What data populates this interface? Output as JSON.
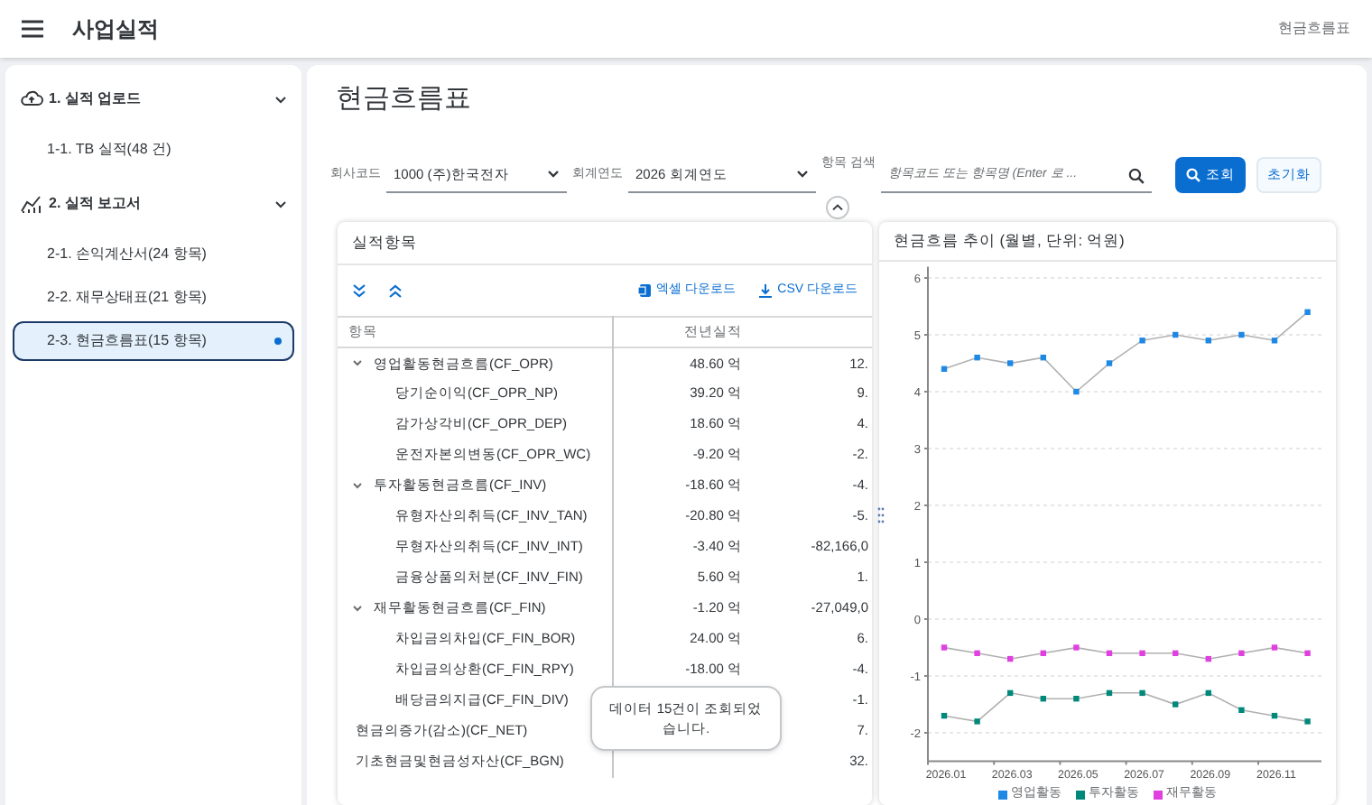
{
  "header": {
    "title": "사업실적",
    "breadcrumb": "현금흐름표"
  },
  "sidebar": {
    "groups": [
      {
        "label": "1. 실적 업로드",
        "expanded": true,
        "items": [
          {
            "label": "1-1. TB 실적(48 건)",
            "selected": false
          }
        ]
      },
      {
        "label": "2. 실적 보고서",
        "expanded": true,
        "items": [
          {
            "label": "2-1. 손익계산서(24 항목)",
            "selected": false
          },
          {
            "label": "2-2. 재무상태표(21 항목)",
            "selected": false
          },
          {
            "label": "2-3. 현금흐름표(15 항목)",
            "selected": true
          }
        ]
      }
    ]
  },
  "page_title": "현금흐름표",
  "filters": [
    {
      "kind": "select",
      "label": "회사코드",
      "value": "1000 (주)한국전자"
    },
    {
      "kind": "select",
      "label": "회계연도",
      "value": "2026 회계연도"
    },
    {
      "kind": "search",
      "label": "항목 검색",
      "placeholder": "항목코드 또는 항목명 (Enter 로 ..."
    }
  ],
  "buttons": [
    {
      "kind": "primary",
      "label": "조회"
    },
    {
      "kind": "secondary",
      "label": "초기화"
    }
  ],
  "table_card": {
    "title": "실적항목",
    "toolbar": [
      {
        "kind": "excel",
        "label": "엑셀 다운로드"
      },
      {
        "kind": "csv",
        "label": "CSV 다운로드"
      }
    ],
    "columns": [
      "항목",
      "전년실적"
    ],
    "rows": [
      {
        "name": "영업활동현금흐름(CF_OPR)",
        "expanded": true,
        "prior": "48.60 억",
        "column_3": "12.",
        "children": [
          {
            "name": "당기순이익(CF_OPR_NP)",
            "prior": "39.20 억",
            "column_3": "9."
          },
          {
            "name": "감가상각비(CF_OPR_DEP)",
            "prior": "18.60 억",
            "column_3": "4."
          },
          {
            "name": "운전자본의변동(CF_OPR_WC)",
            "prior": "-9.20 억",
            "column_3": "-2."
          }
        ]
      },
      {
        "name": "투자활동현금흐름(CF_INV)",
        "expanded": true,
        "prior": "-18.60 억",
        "column_3": "-4.",
        "children": [
          {
            "name": "유형자산의취득(CF_INV_TAN)",
            "prior": "-20.80 억",
            "column_3": "-5."
          },
          {
            "name": "무형자산의취득(CF_INV_INT)",
            "prior": "-3.40 억",
            "column_3": "-82,166,0"
          },
          {
            "name": "금융상품의처분(CF_INV_FIN)",
            "prior": "5.60 억",
            "column_3": "1."
          }
        ]
      },
      {
        "name": "재무활동현금흐름(CF_FIN)",
        "expanded": true,
        "prior": "-1.20 억",
        "column_3": "-27,049,0",
        "children": [
          {
            "name": "차입금의차입(CF_FIN_BOR)",
            "prior": "24.00 억",
            "column_3": "6."
          },
          {
            "name": "차입금의상환(CF_FIN_RPY)",
            "prior": "-18.00 억",
            "column_3": "-4."
          },
          {
            "name": "배당금의지급(CF_FIN_DIV)",
            "column_3": "-1."
          }
        ]
      },
      {
        "name": "현금의증가(감소)(CF_NET)",
        "column_3": "7."
      },
      {
        "name": "기초현금및현금성자산(CF_BGN)",
        "column_3": "32."
      }
    ]
  },
  "toast": "데이터 15건이 조회되었습니다.",
  "chart_card": {
    "title": "현금흐름 추이 (월별, 단위: 억원)",
    "chart_data": {
      "type": "line",
      "grid": true,
      "categories": [
        "2026.01",
        null,
        "2026.03",
        null,
        "2026.05",
        null,
        "2026.07",
        null,
        "2026.09",
        null,
        "2026.11",
        null
      ],
      "ylim": [
        -2.5,
        6.2
      ],
      "yticks": [
        -2,
        -1,
        0,
        1,
        2,
        3,
        4,
        5,
        6
      ],
      "series": [
        {
          "name": "영업활동",
          "color": "#1e88e5",
          "marker": "square",
          "values": [
            4.4,
            4.6,
            4.5,
            4.6,
            4.0,
            4.5,
            4.9,
            5.0,
            4.9,
            5.0,
            4.9,
            5.4
          ]
        },
        {
          "name": "투자활동",
          "color": "#00897b",
          "marker": "square",
          "values": [
            -1.7,
            -1.8,
            -1.3,
            -1.4,
            -1.4,
            -1.3,
            -1.3,
            -1.5,
            -1.3,
            -1.6,
            -1.7,
            -1.8
          ]
        },
        {
          "name": "재무활동",
          "color": "#e040e0",
          "marker": "square",
          "values": [
            -0.5,
            -0.6,
            -0.7,
            -0.6,
            -0.5,
            -0.6,
            -0.6,
            -0.6,
            -0.7,
            -0.6,
            -0.5,
            -0.6
          ]
        }
      ]
    }
  }
}
